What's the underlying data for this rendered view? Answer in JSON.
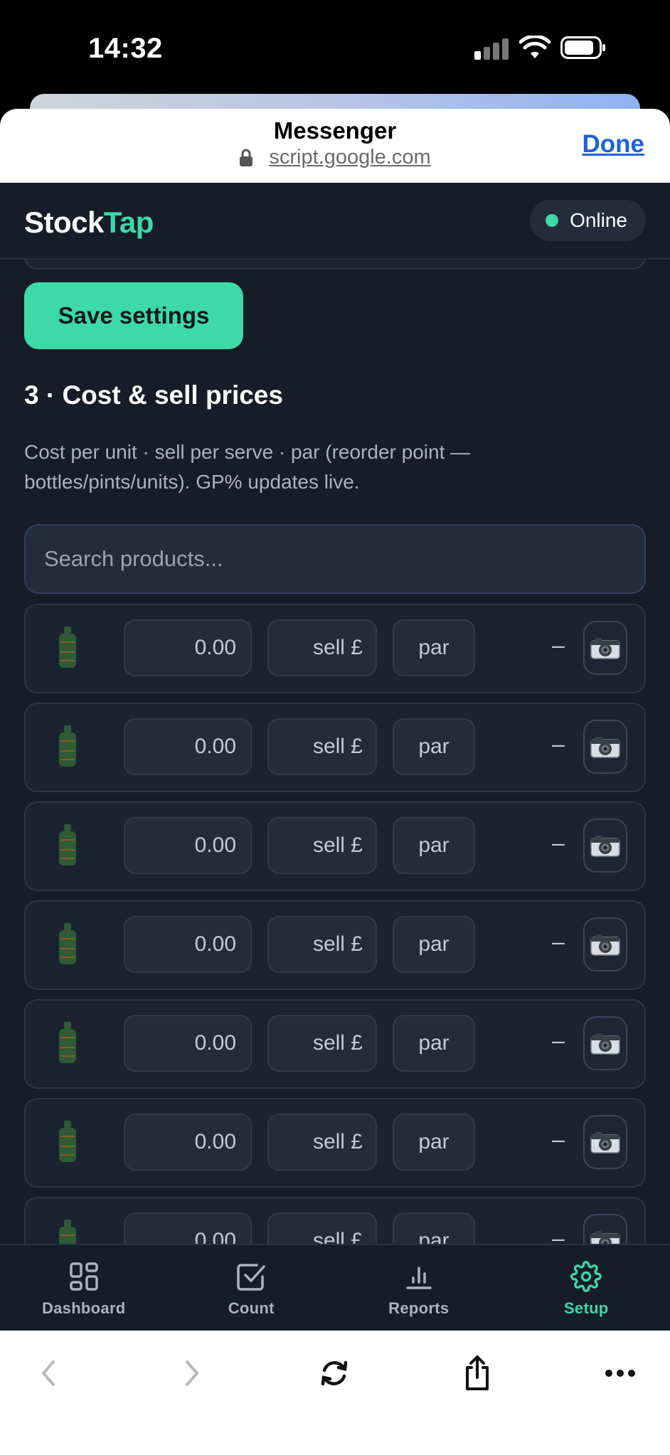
{
  "status_bar": {
    "time": "14:32"
  },
  "browser": {
    "title": "Messenger",
    "url": "script.google.com",
    "done_label": "Done"
  },
  "app": {
    "brand_primary": "Stock",
    "brand_accent": "Tap",
    "status_label": "Online",
    "accent_color": "#3dd9a9"
  },
  "settings": {
    "save_label": "Save settings",
    "section_title": "3 · Cost & sell prices",
    "section_description": "Cost per unit · sell per serve · par (reorder point — bottles/pints/units). GP% updates live.",
    "search_placeholder": "Search products..."
  },
  "products": [
    {
      "cost": "0.00",
      "sell_placeholder": "sell £",
      "par_placeholder": "par",
      "gp": "–"
    },
    {
      "cost": "0.00",
      "sell_placeholder": "sell £",
      "par_placeholder": "par",
      "gp": "–"
    },
    {
      "cost": "0.00",
      "sell_placeholder": "sell £",
      "par_placeholder": "par",
      "gp": "–"
    },
    {
      "cost": "0.00",
      "sell_placeholder": "sell £",
      "par_placeholder": "par",
      "gp": "–"
    },
    {
      "cost": "0.00",
      "sell_placeholder": "sell £",
      "par_placeholder": "par",
      "gp": "–"
    },
    {
      "cost": "0.00",
      "sell_placeholder": "sell £",
      "par_placeholder": "par",
      "gp": "–"
    },
    {
      "cost": "0.00",
      "sell_placeholder": "sell £",
      "par_placeholder": "par",
      "gp": "–"
    }
  ],
  "nav": [
    {
      "label": "Dashboard",
      "icon": "dashboard-icon",
      "active": false
    },
    {
      "label": "Count",
      "icon": "checkbox-icon",
      "active": false
    },
    {
      "label": "Reports",
      "icon": "bar-chart-icon",
      "active": false
    },
    {
      "label": "Setup",
      "icon": "gear-icon",
      "active": true
    }
  ]
}
